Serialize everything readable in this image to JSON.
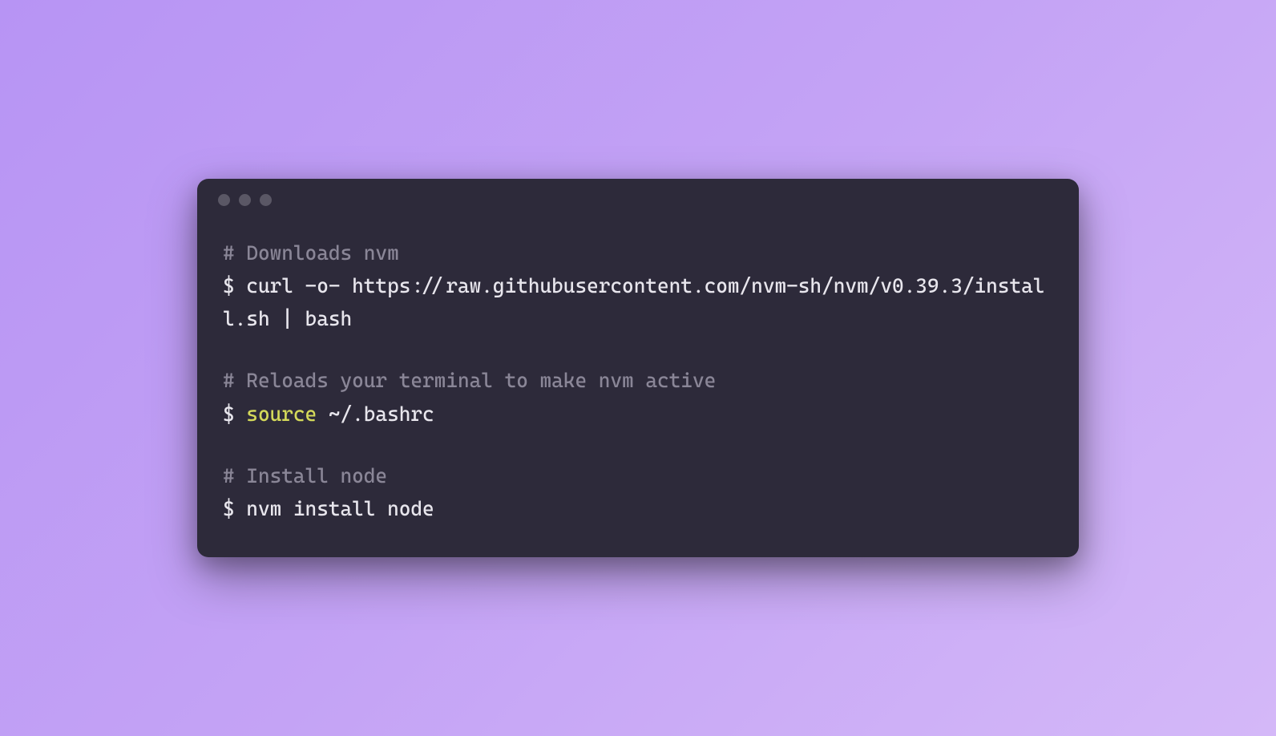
{
  "terminal": {
    "blocks": [
      {
        "comment": "# Downloads nvm",
        "prompt": "$ ",
        "command": "curl -o- https://raw.githubusercontent.com/nvm-sh/nvm/v0.39.3/install.sh | bash"
      },
      {
        "comment": "# Reloads your terminal to make nvm active",
        "prompt": "$ ",
        "keyword": "source",
        "command_rest": " ~/.bashrc"
      },
      {
        "comment": "# Install node",
        "prompt": "$ ",
        "command": "nvm install node"
      }
    ]
  }
}
